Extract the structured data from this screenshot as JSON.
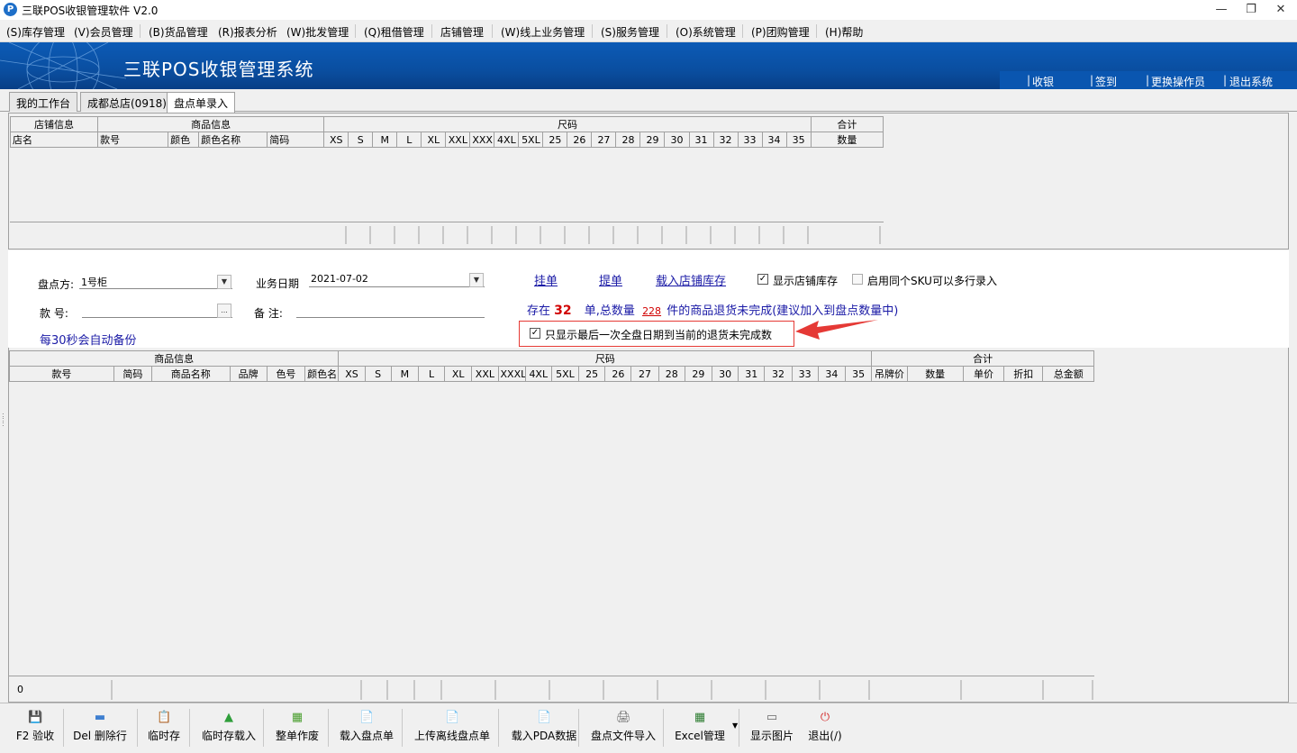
{
  "window": {
    "title": "三联POS收银管理软件 V2.0",
    "logo_letter": "P"
  },
  "menu": [
    "(S)库存管理",
    "(V)会员管理",
    "(B)货品管理",
    "(R)报表分析",
    "(W)批发管理",
    "(Q)租借管理",
    "店铺管理",
    "(W)线上业务管理",
    "(S)服务管理",
    "(O)系统管理",
    "(P)团购管理",
    "(H)帮助"
  ],
  "banner": {
    "title": "三联POS收银管理系统",
    "links": [
      "收银",
      "签到",
      "更换操作员",
      "退出系统"
    ]
  },
  "tabs": [
    "我的工作台",
    "成都总店(0918)",
    "盘点单录入"
  ],
  "top_grid": {
    "groups": [
      "店铺信息",
      "商品信息",
      "尺码",
      "合计"
    ],
    "columns": [
      "店名",
      "款号",
      "颜色",
      "颜色名称",
      "简码",
      "XS",
      "S",
      "M",
      "L",
      "XL",
      "XXL",
      "XXXL",
      "4XL",
      "5XL",
      "25",
      "26",
      "27",
      "28",
      "29",
      "30",
      "31",
      "32",
      "33",
      "34",
      "35",
      "数量"
    ]
  },
  "form": {
    "party_label": "盘点方:",
    "party_value": "1号柜",
    "date_label": "业务日期",
    "date_value": "2021-07-02",
    "style_label": "款  号:",
    "style_button": "...",
    "note_label": "备  注:",
    "autosave": "每30秒会自动备份",
    "links": [
      "挂单",
      "提单",
      "载入店铺库存"
    ],
    "show_stock_label": "显示店铺库存",
    "same_sku_label": "启用同个SKU可以多行录入",
    "notice_pre": "存在",
    "notice_count": "32",
    "notice_mid": "单,总数量",
    "notice_qty": "228",
    "notice_post": "件的商品退货未完成(建议加入到盘点数量中)",
    "only_last_label": "只显示最后一次全盘日期到当前的退货未完成数"
  },
  "bottom_grid": {
    "groups": [
      "商品信息",
      "尺码",
      "合计"
    ],
    "columns": [
      "款号",
      "简码",
      "商品名称",
      "品牌",
      "色号",
      "颜色名",
      "XS",
      "S",
      "M",
      "L",
      "XL",
      "XXL",
      "XXXL",
      "4XL",
      "5XL",
      "25",
      "26",
      "27",
      "28",
      "29",
      "30",
      "31",
      "32",
      "33",
      "34",
      "35",
      "吊牌价",
      "数量",
      "单价",
      "折扣",
      "总金额"
    ],
    "footer_count": "0"
  },
  "toolbar": [
    {
      "label": "F2 验收",
      "icon": "save-icon"
    },
    {
      "label": "Del 删除行",
      "icon": "delete-row-icon"
    },
    {
      "label": "临时存",
      "icon": "temp-save-icon"
    },
    {
      "label": "临时存载入",
      "icon": "temp-load-icon"
    },
    {
      "label": "整单作废",
      "icon": "void-basket-icon"
    },
    {
      "label": "载入盘点单",
      "icon": "load-doc-icon"
    },
    {
      "label": "上传离线盘点单",
      "icon": "upload-doc-icon"
    },
    {
      "label": "载入PDA数据",
      "icon": "pda-icon"
    },
    {
      "label": "盘点文件导入",
      "icon": "file-import-icon"
    },
    {
      "label": "Excel管理",
      "icon": "excel-icon"
    },
    {
      "label": "显示图片",
      "icon": "image-icon"
    },
    {
      "label": "退出(/)",
      "icon": "exit-icon"
    }
  ],
  "colors": {
    "banner": "#0a4ea0",
    "link": "#1a1aa6",
    "alert_red": "#d10000",
    "arrow": "#e53935"
  }
}
